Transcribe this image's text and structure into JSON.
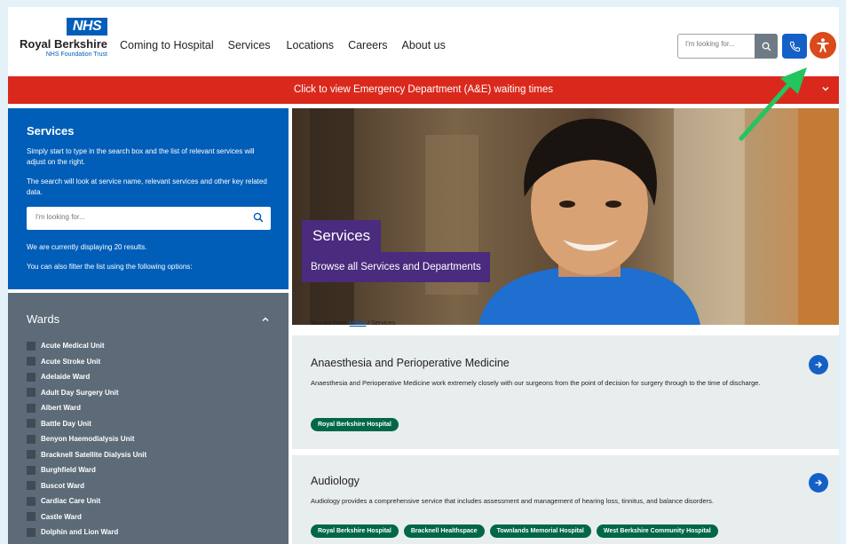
{
  "header": {
    "logo_badge": "NHS",
    "trust_name": "Royal Berkshire",
    "trust_sub": "NHS Foundation Trust",
    "nav": [
      "Coming to Hospital",
      "Services",
      "Locations",
      "Careers",
      "About us"
    ],
    "search_placeholder": "I'm looking for...",
    "icons": {
      "search": "search-icon",
      "phone": "phone-icon",
      "accessibility": "accessibility-icon"
    }
  },
  "banner": {
    "text": "Click to view Emergency Department (A&E) waiting times"
  },
  "services_panel": {
    "title": "Services",
    "p1": "Simply start to type in the search box and the list of relevant services will adjust on the right.",
    "p2": "The search will look at service name, relevant services and other key related data.",
    "search_placeholder": "I'm looking for...",
    "results": "We are currently displaying 20 results.",
    "filter_hint": "You can also filter the list using the following options:"
  },
  "wards": {
    "title": "Wards",
    "items": [
      "Acute Medical Unit",
      "Acute Stroke Unit",
      "Adelaide Ward",
      "Adult Day Surgery Unit",
      "Albert Ward",
      "Battle Day Unit",
      "Benyon Haemodialysis Unit",
      "Bracknell Satellite Dialysis Unit",
      "Burghfield Ward",
      "Buscot Ward",
      "Cardiac Care Unit",
      "Castle Ward",
      "Dolphin and Lion Ward"
    ]
  },
  "hero": {
    "title": "Services",
    "subtitle": "Browse all Services and Departments"
  },
  "breadcrumb": {
    "prefix": "You are here: ",
    "home": "Home",
    "current": " / Services"
  },
  "cards": [
    {
      "title": "Anaesthesia and Perioperative Medicine",
      "desc": "Anaesthesia and Perioperative Medicine work extremely closely with our surgeons from the point of decision for surgery through to the time of discharge.",
      "tags": [
        "Royal Berkshire Hospital"
      ]
    },
    {
      "title": "Audiology",
      "desc": "Audiology provides a comprehensive service that includes assessment and management of hearing loss, tinnitus, and balance disorders.",
      "tags": [
        "Royal Berkshire Hospital",
        "Bracknell Healthspace",
        "Townlands Memorial Hospital",
        "West Berkshire Community Hospital"
      ]
    }
  ],
  "colors": {
    "nhs_blue": "#005eb8",
    "banner_red": "#da291c",
    "accessibility_orange": "#da4a1a",
    "tag_green": "#006747",
    "hero_purple": "#4a2b7e",
    "annotation_arrow": "#22c55e"
  }
}
